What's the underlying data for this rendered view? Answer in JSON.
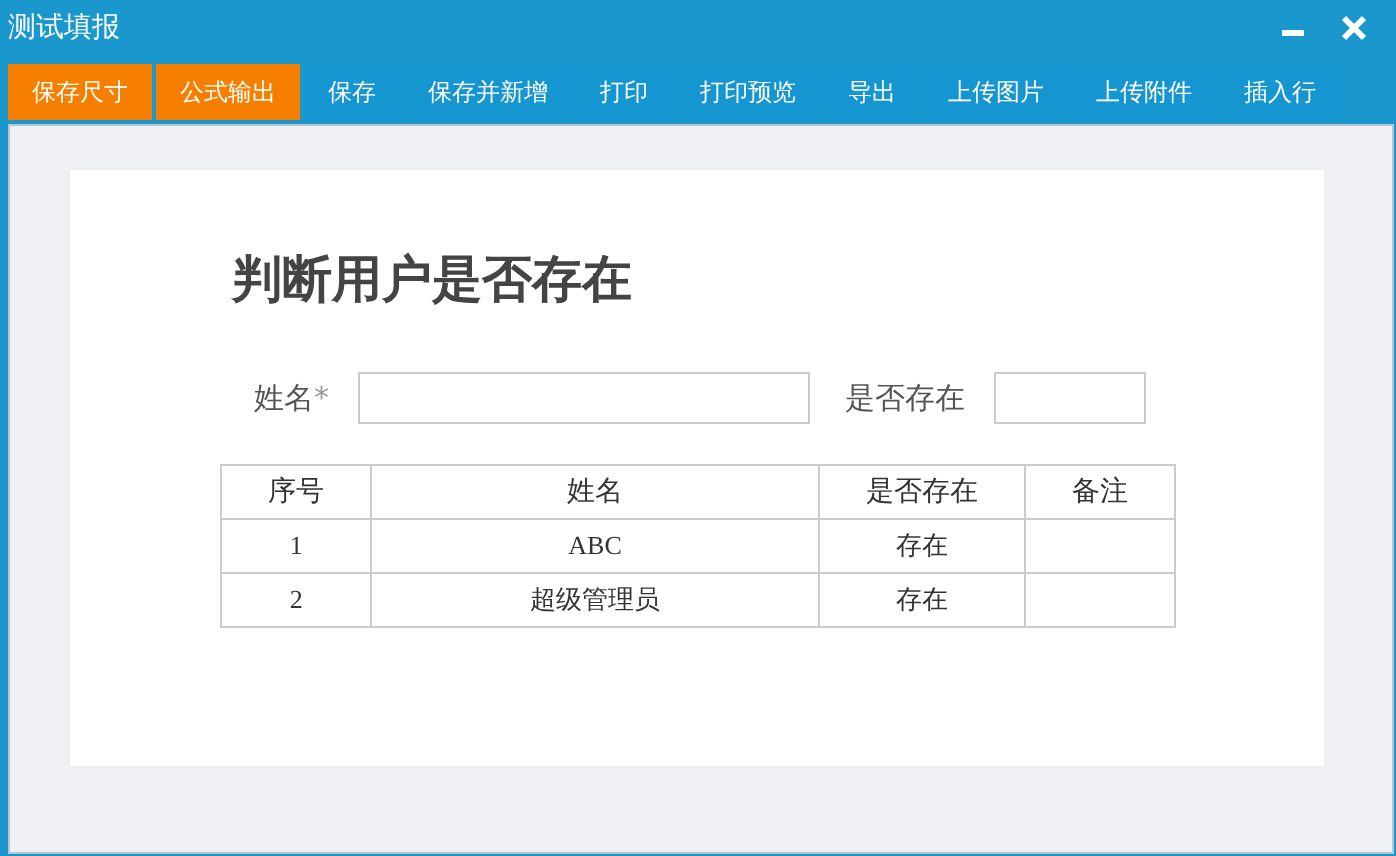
{
  "window": {
    "title": "测试填报"
  },
  "toolbar": [
    {
      "label": "保存尺寸",
      "color": "#f77f00"
    },
    {
      "label": "公式输出",
      "color": "#f77f00"
    },
    {
      "label": "保存",
      "color": "#1596d0"
    },
    {
      "label": "保存并新增",
      "color": "#1596d0"
    },
    {
      "label": "打印",
      "color": "#1596d0"
    },
    {
      "label": "打印预览",
      "color": "#1596d0"
    },
    {
      "label": "导出",
      "color": "#1596d0"
    },
    {
      "label": "上传图片",
      "color": "#1596d0"
    },
    {
      "label": "上传附件",
      "color": "#1596d0"
    },
    {
      "label": "插入行",
      "color": "#1596d0"
    }
  ],
  "form": {
    "title": "判断用户是否存在",
    "fields": [
      {
        "label": "姓名",
        "required_mark": "*"
      },
      {
        "label": "是否存在"
      }
    ],
    "table": {
      "columns": [
        "序号",
        "姓名",
        "是否存在",
        "备注"
      ],
      "rows": [
        [
          "1",
          "ABC",
          "存在",
          ""
        ],
        [
          "2",
          "超级管理员",
          "存在",
          ""
        ]
      ]
    }
  }
}
